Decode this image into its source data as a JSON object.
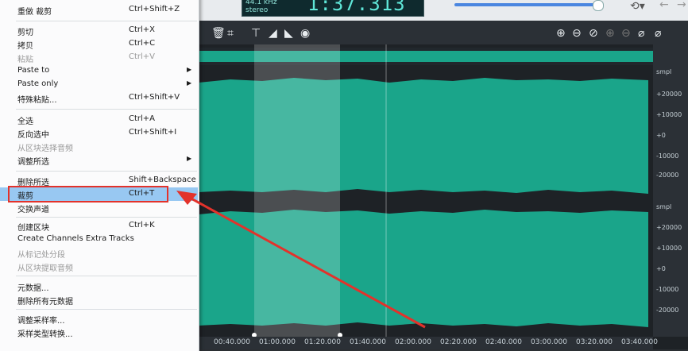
{
  "lcd": {
    "rate": "44.1 kHz",
    "channels": "stereo",
    "time": "1:37.313"
  },
  "toolbar": {
    "icons": [
      "trash-icon",
      "crop-icon",
      "fade-in-icon",
      "fade-out-icon",
      "fade-both-icon",
      "normalize-icon"
    ],
    "zoom_icons": [
      "zoom-in-icon",
      "zoom-out-icon",
      "zoom-fit-icon",
      "zoom-in-disabled-icon",
      "zoom-out-disabled-icon",
      "zoom-selection-icon",
      "zoom-all-icon"
    ]
  },
  "ruler": {
    "ticks": [
      "00:40.000",
      "01:00.000",
      "01:20.000",
      "01:40.000",
      "02:00.000",
      "02:20.000",
      "02:40.000",
      "03:00.000",
      "03:20.000",
      "03:40.000"
    ]
  },
  "scale": {
    "unit": "smpl",
    "labels": [
      "+20000",
      "+10000",
      "+0",
      "-10000",
      "-20000"
    ]
  },
  "menu": {
    "items": [
      {
        "label": "重做 裁剪",
        "shortcut": "Ctrl+Shift+Z"
      },
      {
        "label": "剪切",
        "shortcut": "Ctrl+X"
      },
      {
        "label": "拷贝",
        "shortcut": "Ctrl+C"
      },
      {
        "label": "粘贴",
        "shortcut": "Ctrl+V",
        "disabled": true
      },
      {
        "label": "Paste to",
        "submenu": true
      },
      {
        "label": "Paste only",
        "submenu": true
      },
      {
        "label": "特殊粘贴...",
        "shortcut": "Ctrl+Shift+V"
      },
      {
        "label": "全选",
        "shortcut": "Ctrl+A"
      },
      {
        "label": "反向选中",
        "shortcut": "Ctrl+Shift+I"
      },
      {
        "label": "从区块选择音频",
        "disabled": true
      },
      {
        "label": "调整所选",
        "submenu": true
      },
      {
        "label": "删除所选",
        "shortcut": "Shift+Backspace"
      },
      {
        "label": "裁剪",
        "shortcut": "Ctrl+T",
        "highlighted": true
      },
      {
        "label": "交换声道"
      },
      {
        "label": "创建区块",
        "shortcut": "Ctrl+K"
      },
      {
        "label": "Create Channels Extra Tracks"
      },
      {
        "label": "从标记处分段",
        "disabled": true
      },
      {
        "label": "从区块提取音频",
        "disabled": true
      },
      {
        "label": "元数据..."
      },
      {
        "label": "删除所有元数据"
      },
      {
        "label": "调整采样率..."
      },
      {
        "label": "采样类型转换..."
      }
    ]
  },
  "colors": {
    "waveform": "#1aa58a",
    "waveform_bg": "#1e2226",
    "selection": "#7ecfbf",
    "highlight": "#98c8f2",
    "annotation": "#e3322b"
  }
}
